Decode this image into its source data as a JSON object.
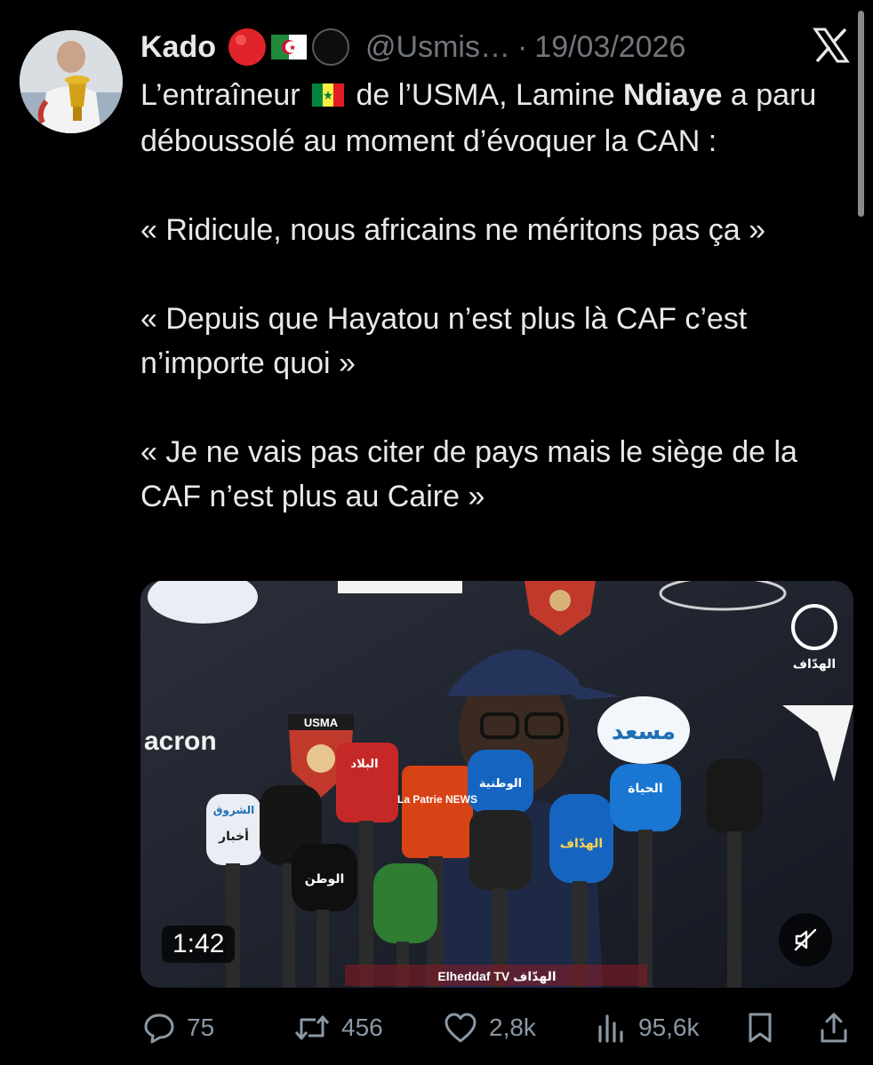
{
  "post": {
    "display_name": "Kado",
    "name_emojis": [
      "red-circle",
      "algeria-flag",
      "black-circle"
    ],
    "handle": "@Usmis…",
    "separator": "·",
    "date": "19/03/2026",
    "platform_icon": "x-logo-icon",
    "text": {
      "p1_a": "L’entraîneur",
      "p1_flag": "senegal-flag",
      "p1_b": "de l’USMA, Lamine",
      "p1_bold": "Ndiaye",
      "p1_c": "a paru déboussolé au moment d’évoquer la CAN :",
      "quote1": "« Ridicule, nous africains ne méritons pas ça »",
      "quote2": "« Depuis que Hayatou n’est plus là CAF c’est n’importe quoi »",
      "quote3": "« Je ne vais pas citer de pays mais le siège de la CAF n’est plus au Caire »"
    },
    "media": {
      "type": "video",
      "duration": "1:42",
      "muted_icon": "speaker-muted-icon",
      "watermark": "Elheddaf TV الهدّاف",
      "backdrop_text": {
        "acron": "acron",
        "usma": "USMA",
        "macron": "macron",
        "messad_arabic": "مسعد",
        "mic_labels": [
          "البلاد",
          "La Patrie NEWS",
          "الوطنية",
          "الحياة",
          "الهدّاف",
          "الشروق",
          "أخبار",
          "الوطن"
        ]
      }
    },
    "actions": {
      "replies": "75",
      "reposts": "456",
      "likes": "2,8k",
      "views": "95,6k"
    }
  },
  "colors": {
    "background": "#000000",
    "text": "#e7e9ea",
    "muted": "#71767b",
    "action": "#8b98a5"
  }
}
